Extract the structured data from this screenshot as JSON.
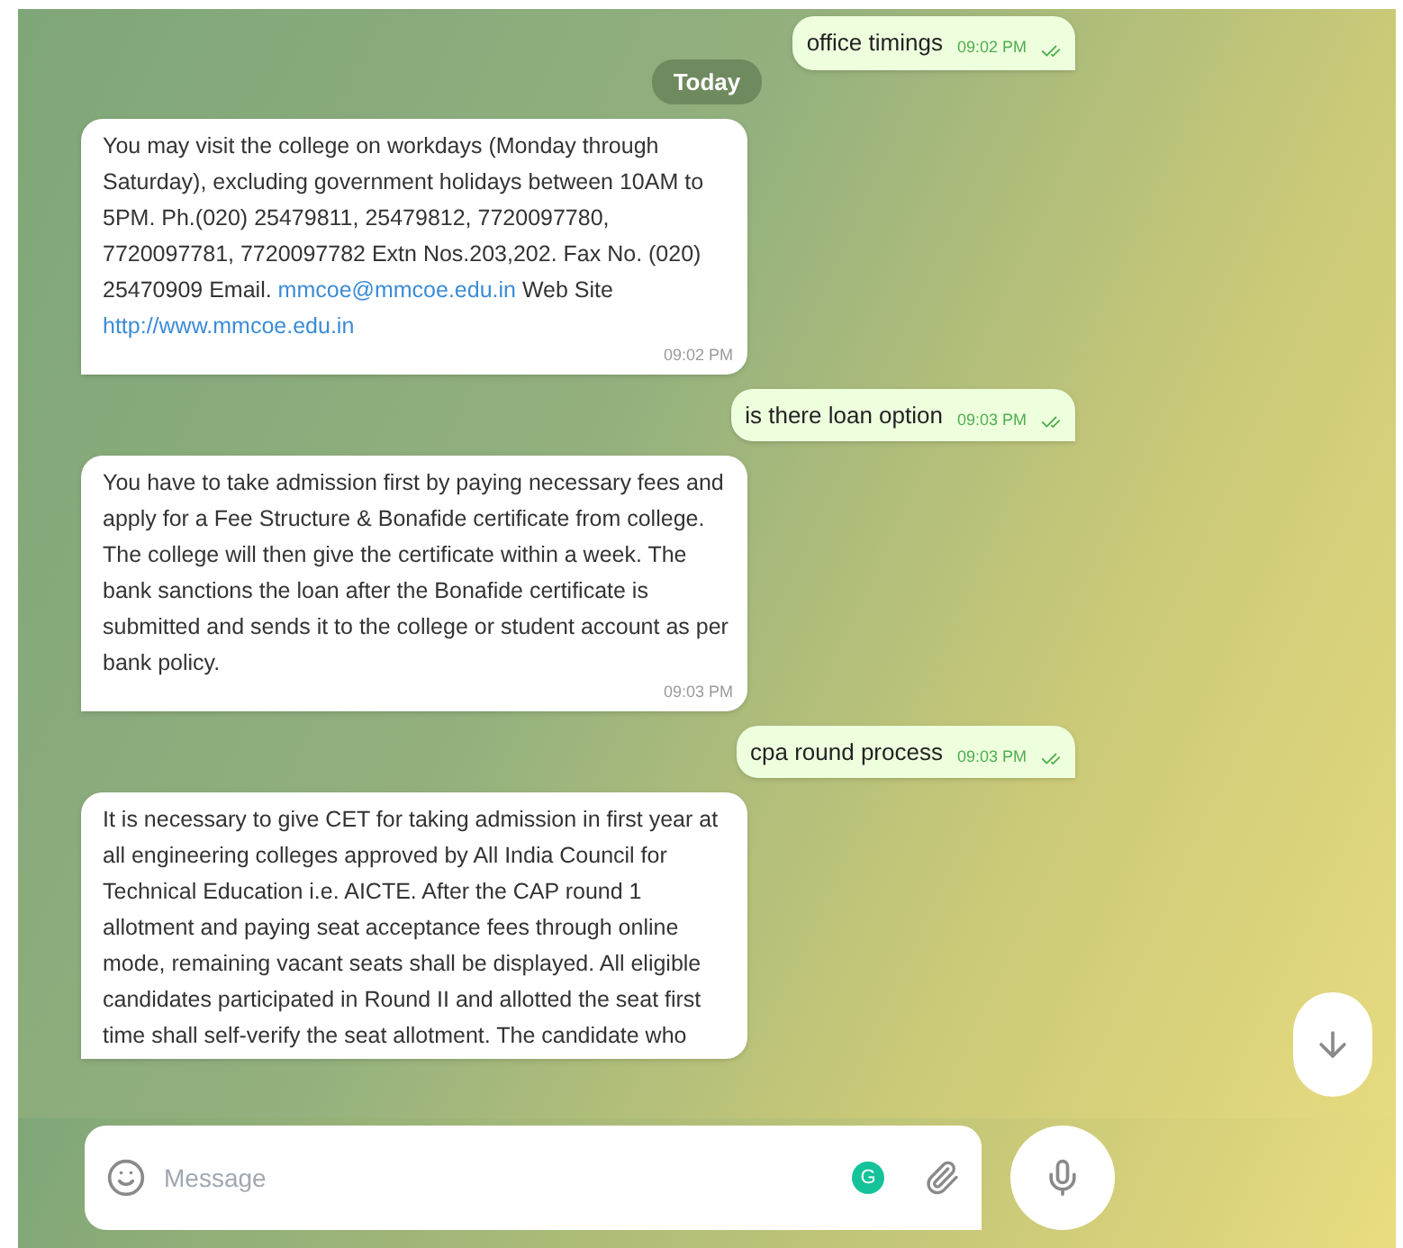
{
  "messages": [
    {
      "kind": "out",
      "text": "office timings",
      "time": "09:02 PM",
      "read": true
    },
    {
      "kind": "date",
      "text": "Today"
    },
    {
      "kind": "in",
      "parts": [
        {
          "kind": "text",
          "text": "You may visit the college on workdays (Monday through Saturday), excluding government holidays between 10AM to 5PM. Ph.(020) 25479811, 25479812, 7720097780, 7720097781, 7720097782 Extn Nos.203,202. Fax No. (020) 25470909 Email. "
        },
        {
          "kind": "link",
          "text": "mmcoe@mmcoe.edu.in"
        },
        {
          "kind": "text",
          "text": " Web Site "
        },
        {
          "kind": "link",
          "text": "http://www.mmcoe.edu.in"
        }
      ],
      "time": "09:02 PM"
    },
    {
      "kind": "out",
      "text": "is there loan option",
      "time": "09:03 PM",
      "read": true
    },
    {
      "kind": "in",
      "parts": [
        {
          "kind": "text",
          "text": "You have to take admission first by paying necessary fees and apply for a Fee Structure & Bonafide certificate from college. The college will then give the certificate within a week. The bank sanctions the loan after the Bonafide certificate is submitted and sends it to the college or student account as per bank policy."
        }
      ],
      "time": "09:03 PM"
    },
    {
      "kind": "out",
      "text": "cpa round process",
      "time": "09:03 PM",
      "read": true
    },
    {
      "kind": "in",
      "parts": [
        {
          "kind": "text",
          "text": "It is necessary to give CET for taking admission in first year at all engineering colleges approved by All India Council for Technical Education i.e. AICTE. After the CAP round 1 allotment and paying seat acceptance fees through online mode, remaining vacant seats shall be displayed. All eligible candidates participated in Round II and allotted the seat first time shall self-verify the seat allotment. The candidate who"
        }
      ]
    }
  ],
  "composer": {
    "placeholder": "Message",
    "badge": "G"
  }
}
